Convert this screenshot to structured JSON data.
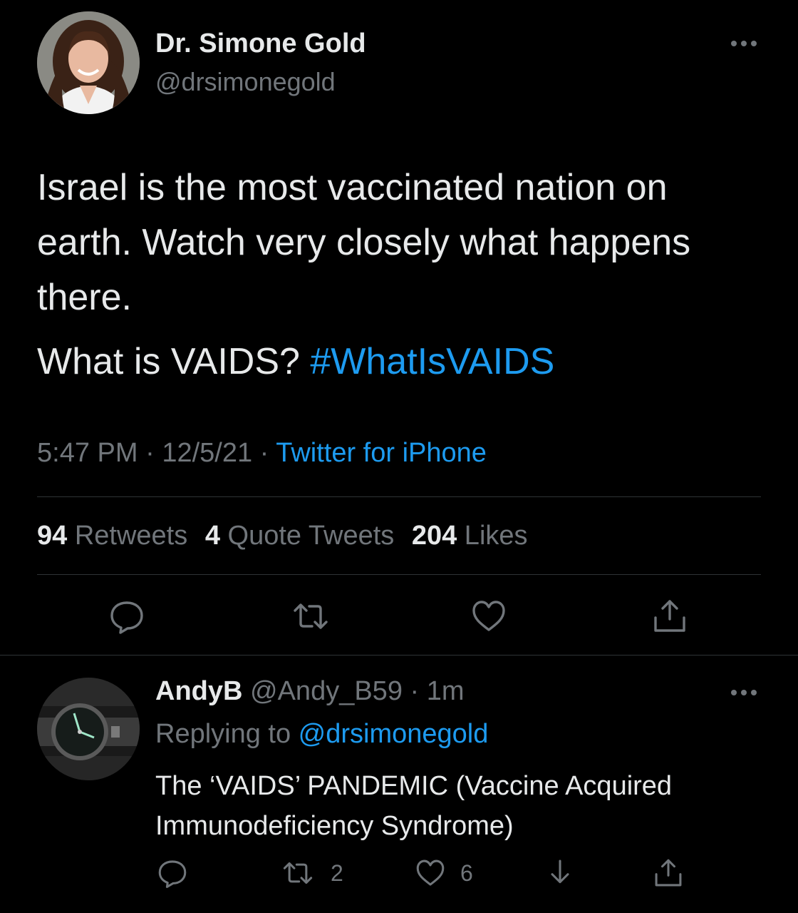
{
  "tweet": {
    "author_name": "Dr. Simone Gold",
    "author_handle": "@drsimonegold",
    "text_paragraph_1": "Israel is the most vaccinated nation on earth. Watch very closely what happens there.",
    "text_paragraph_2_plain": "What is VAIDS? ",
    "text_paragraph_2_hashtag": "#WhatIsVAIDS",
    "time": "5:47 PM",
    "date": "12/5/21",
    "separator": " · ",
    "source": "Twitter for iPhone",
    "retweets_count": "94",
    "retweets_label": " Retweets",
    "quotes_count": "4",
    "quotes_label": " Quote Tweets",
    "likes_count": "204",
    "likes_label": " Likes",
    "icons": [
      "more-icon",
      "reply-icon",
      "retweet-icon",
      "like-icon",
      "share-icon"
    ]
  },
  "reply": {
    "name": "AndyB",
    "handle": " @Andy_B59",
    "time": " · 1m",
    "replying_prefix": "Replying to ",
    "replying_to": "@drsimonegold",
    "text": "The ‘VAIDS’ PANDEMIC (Vaccine Acquired Immunodeficiency Syndrome)",
    "retweet_count": "2",
    "like_count": "6",
    "icons": [
      "more-icon",
      "reply-icon",
      "retweet-icon",
      "like-icon",
      "download-icon",
      "share-icon"
    ]
  },
  "colors": {
    "background": "#000000",
    "text": "#e7e9ea",
    "secondary": "#71767b",
    "link": "#1d9bf0",
    "divider": "#2f3336"
  }
}
